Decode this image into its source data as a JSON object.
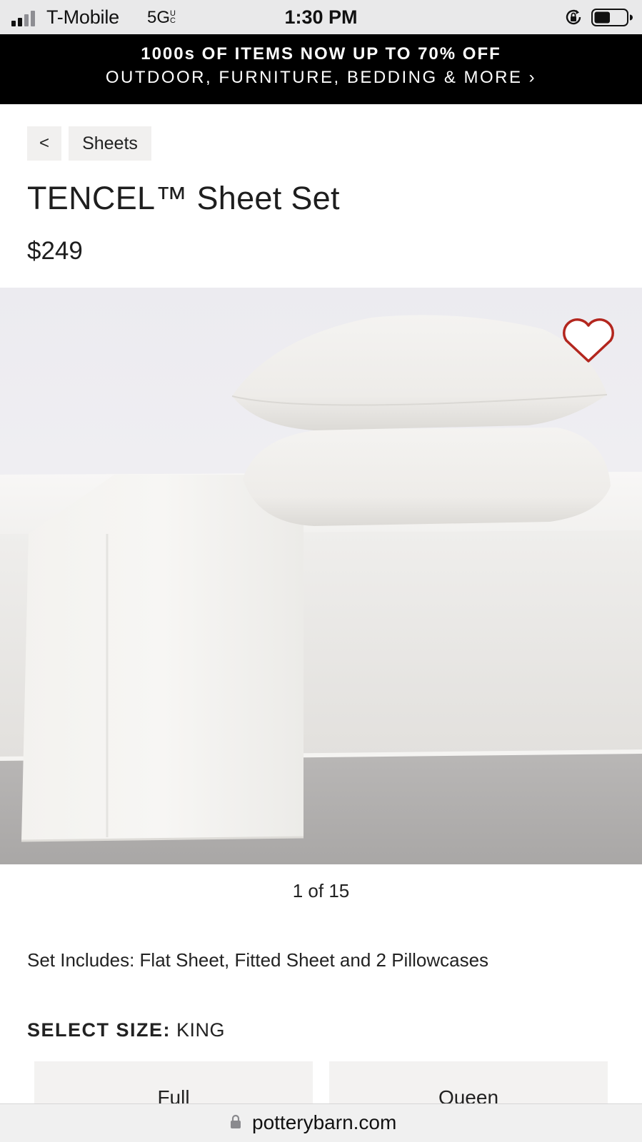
{
  "status_bar": {
    "carrier": "T-Mobile",
    "network": "5G",
    "network_suffix": "UC",
    "time": "1:30 PM",
    "signal_bars_filled": 2,
    "signal_bars_total": 4,
    "battery_level": 0.5
  },
  "promo": {
    "line1": "1000s OF ITEMS NOW UP TO 70% OFF",
    "line2": "OUTDOOR, FURNITURE, BEDDING & MORE ›"
  },
  "breadcrumb": {
    "back_label": "<",
    "category": "Sheets"
  },
  "product": {
    "title": "TENCEL™ Sheet Set",
    "price": "$249",
    "image_alt_icon": "heart-icon",
    "image_counter": "1 of 15",
    "set_includes": "Set Includes: Flat Sheet, Fitted Sheet and 2 Pillowcases"
  },
  "size": {
    "label": "SELECT SIZE:",
    "selected": "KING",
    "options": [
      "Full",
      "Queen"
    ]
  },
  "browser": {
    "domain": "potterybarn.com"
  },
  "colors": {
    "promo_bg": "#000000",
    "wishlist_heart": "#c0392b",
    "chip_bg": "#f1f0ef"
  }
}
